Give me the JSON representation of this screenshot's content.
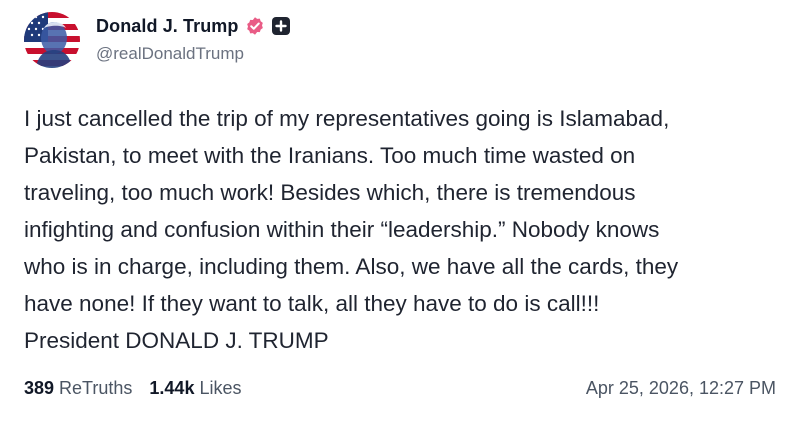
{
  "author": {
    "display_name": "Donald J. Trump",
    "handle": "@realDonaldTrump",
    "avatar_icon": "flag-portrait-avatar",
    "verified_icon": "verified-badge-icon",
    "extra_badge_icon": "plus-badge-icon"
  },
  "post": {
    "text": "I just cancelled the trip of my representatives going is Islamabad,\nPakistan, to meet with the Iranians. Too much time wasted on\ntraveling, too much work! Besides which, there is tremendous\ninfighting and confusion within their “leadership.” Nobody knows\nwho is in charge, including them. Also, we have all the cards, they\nhave none! If they want to talk, all they have to do is call!!!\nPresident DONALD J. TRUMP"
  },
  "stats": {
    "retruths_count": "389",
    "retruths_label": "ReTruths",
    "likes_count": "1.44k",
    "likes_label": "Likes"
  },
  "timestamp": "Apr 25, 2026, 12:27 PM",
  "colors": {
    "verified": "#e95c86",
    "text": "#1f2430",
    "muted": "#6b7280"
  }
}
